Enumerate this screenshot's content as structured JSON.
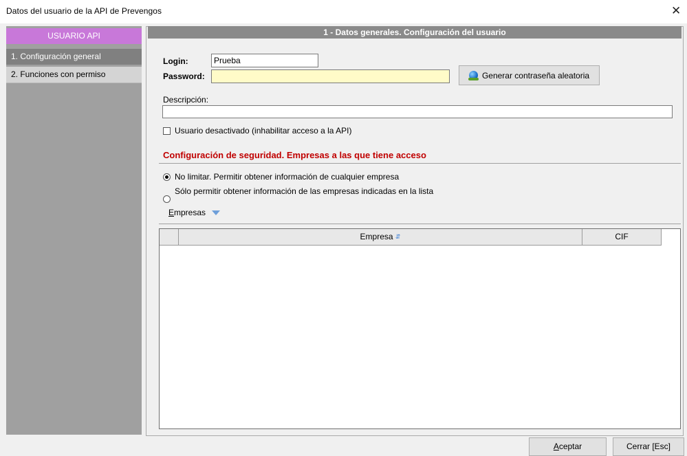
{
  "window": {
    "title": "Datos del usuario de la API de Prevengos",
    "close_glyph": "✕"
  },
  "sidebar": {
    "header": "USUARIO API",
    "items": [
      {
        "label": "1. Configuración general",
        "selected": true
      },
      {
        "label": "2. Funciones con permiso",
        "selected": false
      }
    ]
  },
  "main": {
    "section_title": "1 - Datos generales. Configuración del usuario",
    "login": {
      "label": "Login:",
      "value": "Prueba"
    },
    "password": {
      "label": "Password:",
      "value": ""
    },
    "generate_button": {
      "label": "Generar contraseña aleatoria",
      "icon": "globe-icon"
    },
    "description": {
      "label": "Descripción:",
      "value": ""
    },
    "disabled_checkbox": {
      "label": "Usuario desactivado (inhabilitar acceso a la API)",
      "checked": false
    },
    "security_title": "Configuración de seguridad. Empresas a las que tiene acceso",
    "radio_options": [
      {
        "label": "No limitar. Permitir obtener información de cualquier empresa",
        "selected": true
      },
      {
        "label": "Sólo permitir obtener información de las empresas indicadas en la lista",
        "selected": false
      }
    ],
    "empresas_menu": {
      "label_first": "E",
      "label_rest": "mpresas"
    },
    "grid": {
      "columns": [
        "",
        "Empresa",
        "CIF"
      ],
      "sort_icon_glyph": "⇵",
      "rows": []
    }
  },
  "footer": {
    "accept": {
      "label_first": "A",
      "label_rest": "ceptar"
    },
    "close": {
      "label": "Cerrar [Esc]"
    }
  },
  "colors": {
    "sidebar_header": "#c878d9",
    "sidebar_selected": "#808080",
    "section_header": "#8a8a8a",
    "security_title": "#c00000",
    "password_bg": "#fffbc8"
  }
}
